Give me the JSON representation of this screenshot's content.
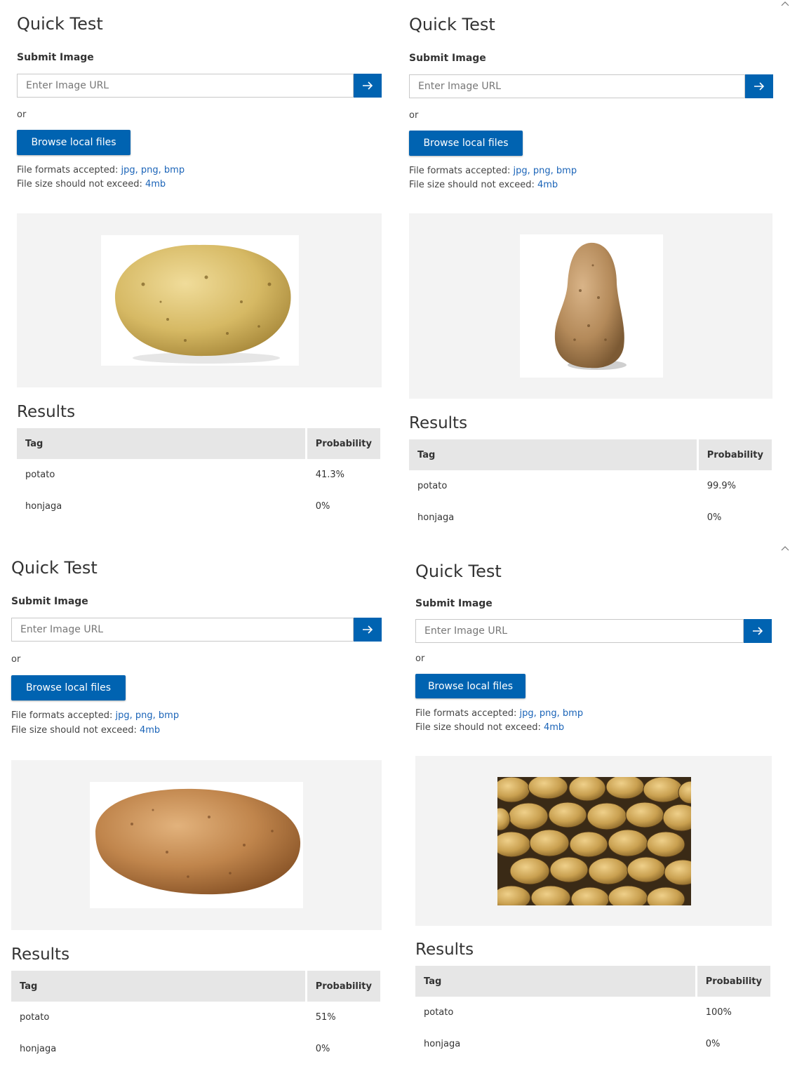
{
  "panels": [
    {
      "title": "Quick Test",
      "submit_label": "Submit Image",
      "url_placeholder": "Enter Image URL",
      "or_text": "or",
      "browse_label": "Browse local files",
      "formats_prefix": "File formats accepted: ",
      "formats": "jpg, png, bmp",
      "size_prefix": "File size should not exceed: ",
      "size_limit": "4mb",
      "image_alt": "round potato",
      "results_title": "Results",
      "col_tag": "Tag",
      "col_prob": "Probability",
      "rows": [
        {
          "tag": "potato",
          "prob": "41.3%"
        },
        {
          "tag": "honjaga",
          "prob": "0%"
        }
      ]
    },
    {
      "title": "Quick Test",
      "submit_label": "Submit Image",
      "url_placeholder": "Enter Image URL",
      "or_text": "or",
      "browse_label": "Browse local files",
      "formats_prefix": "File formats accepted: ",
      "formats": "jpg, png, bmp",
      "size_prefix": "File size should not exceed: ",
      "size_limit": "4mb",
      "image_alt": "upright potato",
      "results_title": "Results",
      "col_tag": "Tag",
      "col_prob": "Probability",
      "rows": [
        {
          "tag": "potato",
          "prob": "99.9%"
        },
        {
          "tag": "honjaga",
          "prob": "0%"
        }
      ]
    },
    {
      "title": "Quick Test",
      "submit_label": "Submit Image",
      "url_placeholder": "Enter Image URL",
      "or_text": "or",
      "browse_label": "Browse local files",
      "formats_prefix": "File formats accepted: ",
      "formats": "jpg, png, bmp",
      "size_prefix": "File size should not exceed: ",
      "size_limit": "4mb",
      "image_alt": "russet potato",
      "results_title": "Results",
      "col_tag": "Tag",
      "col_prob": "Probability",
      "rows": [
        {
          "tag": "potato",
          "prob": "51%"
        },
        {
          "tag": "honjaga",
          "prob": "0%"
        }
      ]
    },
    {
      "title": "Quick Test",
      "submit_label": "Submit Image",
      "url_placeholder": "Enter Image URL",
      "or_text": "or",
      "browse_label": "Browse local files",
      "formats_prefix": "File formats accepted: ",
      "formats": "jpg, png, bmp",
      "size_prefix": "File size should not exceed: ",
      "size_limit": "4mb",
      "image_alt": "pile of potatoes",
      "results_title": "Results",
      "col_tag": "Tag",
      "col_prob": "Probability",
      "rows": [
        {
          "tag": "potato",
          "prob": "100%"
        },
        {
          "tag": "honjaga",
          "prob": "0%"
        }
      ]
    }
  ],
  "colors": {
    "accent": "#0063b1",
    "link": "#1b64b8",
    "preview_bg": "#f3f3f3",
    "table_header_bg": "#e6e6e6"
  },
  "icons": {
    "submit": "arrow-right-icon"
  }
}
